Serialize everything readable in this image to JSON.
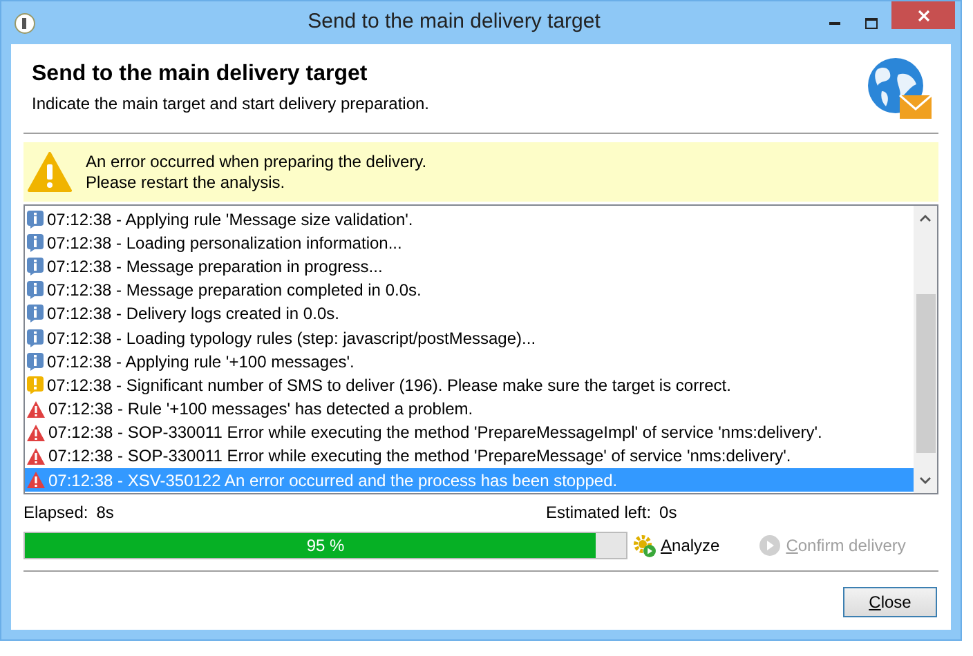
{
  "window": {
    "title": "Send to the main delivery target"
  },
  "header": {
    "title": "Send to the main delivery target",
    "subtitle": "Indicate the main target and start delivery preparation."
  },
  "warning_banner": {
    "lines": [
      "An error occurred when preparing the delivery.",
      "Please restart the analysis."
    ]
  },
  "log": [
    {
      "kind": "info",
      "text": "07:12:38 - Applying rule 'Message size validation'.",
      "selected": false
    },
    {
      "kind": "info",
      "text": "07:12:38 - Loading personalization information...",
      "selected": false
    },
    {
      "kind": "info",
      "text": "07:12:38 - Message preparation in progress...",
      "selected": false
    },
    {
      "kind": "info",
      "text": "07:12:38 - Message preparation completed in 0.0s.",
      "selected": false
    },
    {
      "kind": "info",
      "text": "07:12:38 - Delivery logs created in 0.0s.",
      "selected": false
    },
    {
      "kind": "info",
      "text": "07:12:38 - Loading typology rules (step: javascript/postMessage)...",
      "selected": false
    },
    {
      "kind": "info",
      "text": "07:12:38 - Applying rule '+100 messages'.",
      "selected": false
    },
    {
      "kind": "warning",
      "text": "07:12:38 - Significant number of SMS to deliver (196). Please make sure the target is correct.",
      "selected": false
    },
    {
      "kind": "error",
      "text": "07:12:38 - Rule '+100 messages' has detected a problem.",
      "selected": false
    },
    {
      "kind": "error",
      "text": "07:12:38 - SOP-330011 Error while executing the method 'PrepareMessageImpl' of service 'nms:delivery'.",
      "selected": false
    },
    {
      "kind": "error",
      "text": "07:12:38 - SOP-330011 Error while executing the method 'PrepareMessage' of service 'nms:delivery'.",
      "selected": false
    },
    {
      "kind": "error",
      "text": "07:12:38 - XSV-350122 An error occurred and the process has been stopped.",
      "selected": true
    }
  ],
  "elapsed": {
    "label": "Elapsed:",
    "value": "8s"
  },
  "estimated": {
    "label": "Estimated left:",
    "value": "0s"
  },
  "progress": {
    "level": 0.95,
    "reading": "95 %"
  },
  "analyze_button": {
    "label": "Analyze",
    "disabled": false
  },
  "confirm_button": {
    "label": "Confirm delivery",
    "disabled": true
  },
  "close_button": {
    "label": "Close"
  }
}
